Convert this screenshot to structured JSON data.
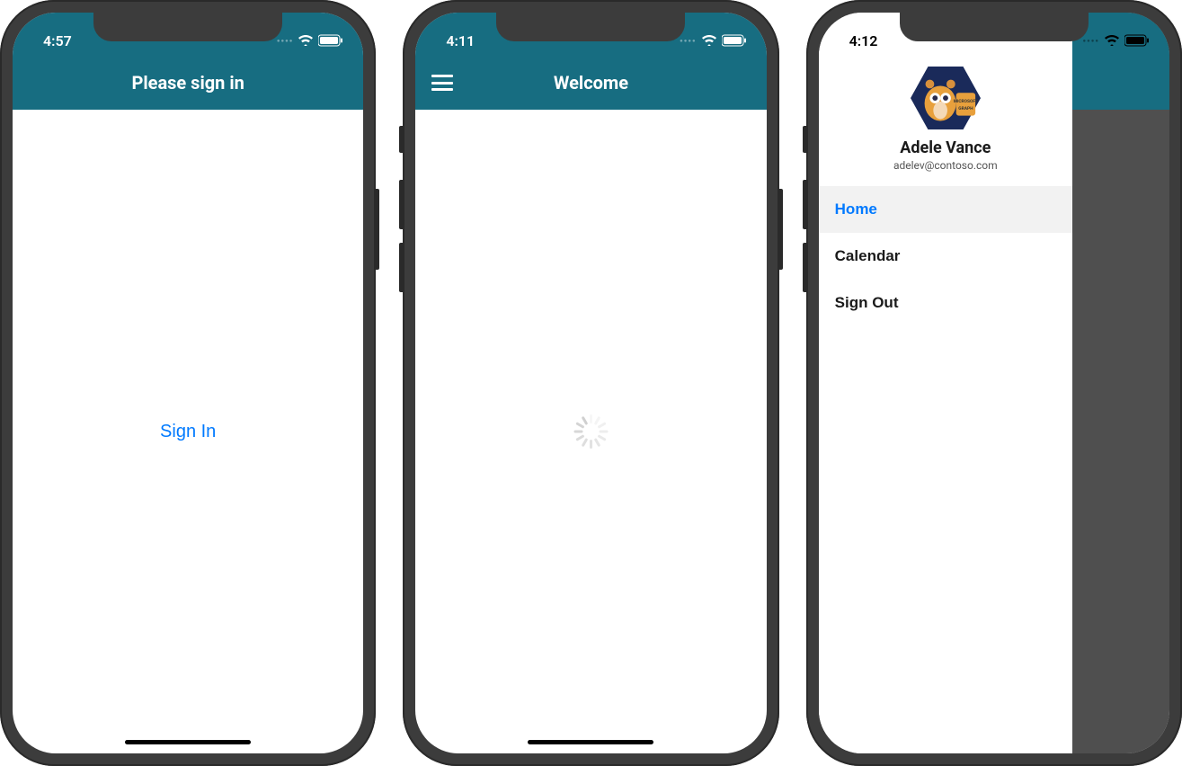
{
  "phone1": {
    "status_time": "4:57",
    "nav_title": "Please sign in",
    "sign_in_label": "Sign In"
  },
  "phone2": {
    "status_time": "4:11",
    "nav_title": "Welcome"
  },
  "phone3": {
    "status_time": "4:12",
    "user_name": "Adele Vance",
    "user_email": "adelev@contoso.com",
    "menu": {
      "home": "Home",
      "calendar": "Calendar",
      "sign_out": "Sign Out"
    }
  },
  "colors": {
    "navbar": "#176d81",
    "link": "#007aff"
  }
}
